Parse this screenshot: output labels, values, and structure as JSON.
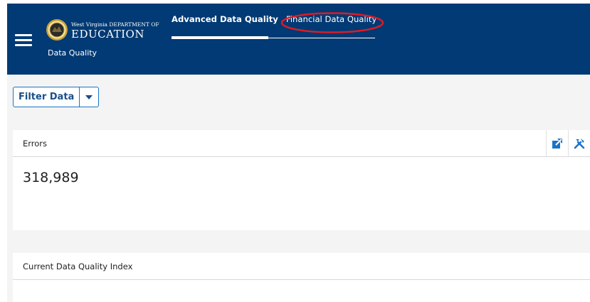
{
  "header": {
    "logo_small": "West Virginia DEPARTMENT OF",
    "logo_main": "EDUCATION",
    "subtitle": "Data Quality",
    "menu_icon": "hamburger-icon",
    "background": "#013a74"
  },
  "tabs": [
    {
      "label": "Advanced Data Quality",
      "active": true
    },
    {
      "label": "Financial Data Quality",
      "active": false
    }
  ],
  "annotation": {
    "target": "Financial Data Quality",
    "color": "#e01b24"
  },
  "filter": {
    "label": "Filter Data",
    "caret_icon": "caret-down-icon"
  },
  "cards": [
    {
      "title": "Errors",
      "value": "318,989",
      "tools": [
        "expand-icon",
        "tools-icon"
      ]
    },
    {
      "title": "Current Data Quality Index"
    }
  ],
  "accent": "#1a73c9"
}
